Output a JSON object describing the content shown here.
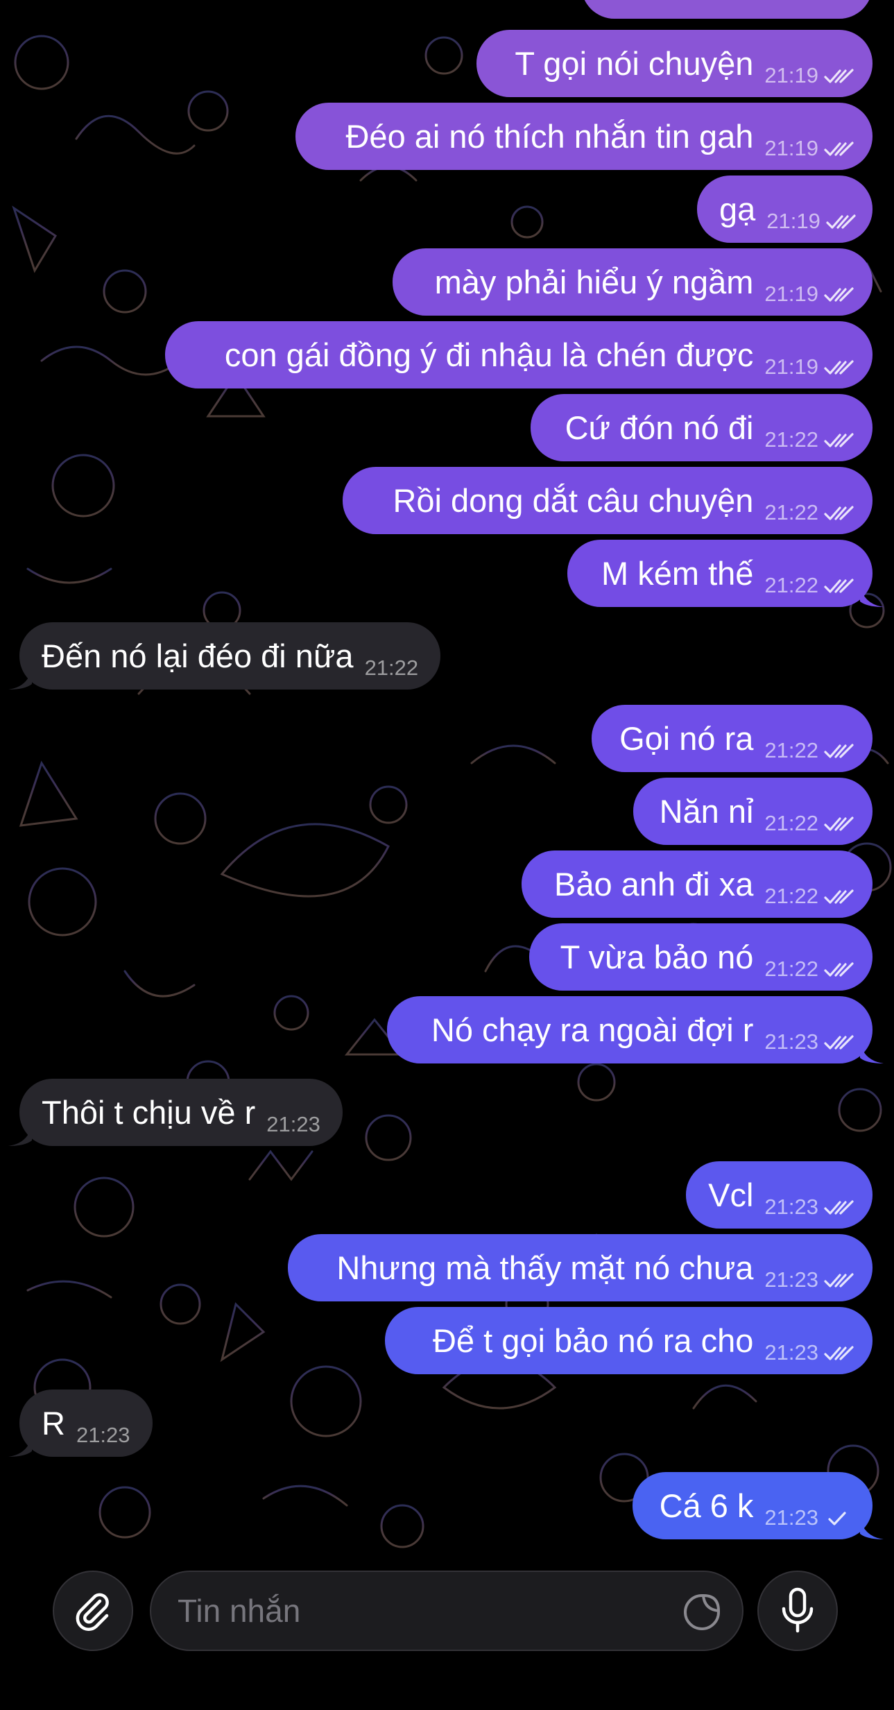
{
  "chat": {
    "messages": [
      {
        "dir": "out",
        "text": "T gọi nói chuyện",
        "time": "21:19",
        "color": "#8a55d6"
      },
      {
        "dir": "out",
        "text": "Đéo ai nó thích nhắn tin gah",
        "time": "21:19",
        "color": "#8753d8"
      },
      {
        "dir": "out",
        "text": "gạ",
        "time": "21:19",
        "color": "#8452da"
      },
      {
        "dir": "out",
        "text": "mày phải hiểu ý ngầm",
        "time": "21:19",
        "color": "#8050dc"
      },
      {
        "dir": "out",
        "text": "con gái đồng ý đi nhậu là chén được",
        "time": "21:19",
        "color": "#7d4fde"
      },
      {
        "dir": "out",
        "text": "Cứ đón nó đi",
        "time": "21:22",
        "color": "#7a4ee0"
      },
      {
        "dir": "out",
        "text": "Rồi dong dắt câu chuyện",
        "time": "21:22",
        "color": "#774de2"
      },
      {
        "dir": "out",
        "text": "M kém thế",
        "time": "21:22",
        "color": "#744ce4"
      },
      {
        "dir": "in",
        "text": "Đến nó lại đéo đi nữa",
        "time": "21:22"
      },
      {
        "dir": "out",
        "text": "Gọi nó ra",
        "time": "21:22",
        "color": "#6f4ee8"
      },
      {
        "dir": "out",
        "text": "Năn nỉ",
        "time": "21:22",
        "color": "#6c4fe9"
      },
      {
        "dir": "out",
        "text": "Bảo anh đi xa",
        "time": "21:22",
        "color": "#6a50ea"
      },
      {
        "dir": "out",
        "text": "T vừa bảo nó",
        "time": "21:22",
        "color": "#6751eb"
      },
      {
        "dir": "out",
        "text": "Nó chạy ra ngoài đợi r",
        "time": "21:23",
        "color": "#6353ec"
      },
      {
        "dir": "in",
        "text": "Thôi t chịu về r",
        "time": "21:23"
      },
      {
        "dir": "out",
        "text": "Vcl",
        "time": "21:23",
        "color": "#5c58ee"
      },
      {
        "dir": "out",
        "text": "Nhưng mà thấy mặt nó chưa",
        "time": "21:23",
        "color": "#595aef"
      },
      {
        "dir": "out",
        "text": "Để t gọi bảo nó ra cho",
        "time": "21:23",
        "color": "#565cf0"
      },
      {
        "dir": "in",
        "text": "R",
        "time": "21:23"
      },
      {
        "dir": "out",
        "text": "Cá 6 k",
        "time": "21:23",
        "color": "#4a63f2"
      }
    ]
  },
  "input": {
    "placeholder": "Tin nhắn",
    "attach_icon": "paperclip-icon",
    "sticker_icon": "sticker-icon",
    "mic_icon": "microphone-icon"
  }
}
